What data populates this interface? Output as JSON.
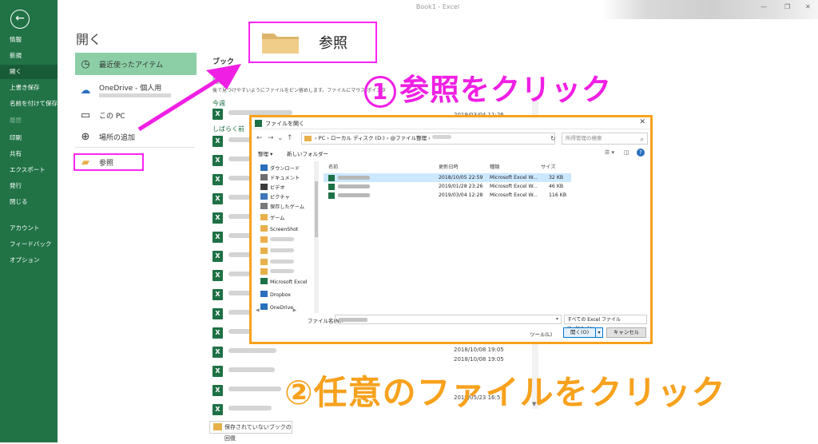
{
  "window": {
    "title": "Book1 - Excel"
  },
  "backstage": {
    "nav": [
      {
        "label": "情報"
      },
      {
        "label": "新規"
      },
      {
        "label": "開く"
      },
      {
        "label": "上書き保存"
      },
      {
        "label": "名前を付けて保存"
      },
      {
        "label": "履歴"
      },
      {
        "label": "印刷"
      },
      {
        "label": "共有"
      },
      {
        "label": "エクスポート"
      },
      {
        "label": "発行"
      },
      {
        "label": "閉じる"
      },
      {
        "label": "アカウント"
      },
      {
        "label": "フィードバック"
      },
      {
        "label": "オプション"
      }
    ],
    "active": "開く"
  },
  "open_pane": {
    "title": "開く",
    "places": {
      "recent": "最近使ったアイテム",
      "onedrive": "OneDrive - 個人用",
      "this_pc": "この PC",
      "add_place": "場所の追加",
      "browse": "参照"
    },
    "recent_header": "ブック",
    "pinned_label": "固定",
    "pinned_tip": "後で見つけやすいようにファイルをピン留めします。ファイルにマウス ポインタ",
    "group_this_week": "今週",
    "group_older": "しばらく前",
    "dates": {
      "d1": "2019/03/04 11:26",
      "d2": "2018/10/08 19:05",
      "d3": "2018/10/08 19:05",
      "d4": "2019/05/23 16:5"
    },
    "recover_button": "保存されていないブックの回復"
  },
  "callout": {
    "browse_label": "参照",
    "step1": "①参照をクリック",
    "step1_text": "参照をクリック",
    "step2_num": "②",
    "step2_text": "任意のファイルをクリック"
  },
  "dialog": {
    "title": "ファイルを開く",
    "address": [
      "PC",
      "ローカル ディスク (D:)",
      "@ファイル整理"
    ],
    "search_placeholder": "所得管理の検索",
    "organize": "整理 ▾",
    "new_folder": "新しいフォルダー",
    "tree": [
      {
        "label": "ダウンロード",
        "icon": "download-icon",
        "color": "#2a6ebd",
        "pin": true
      },
      {
        "label": "ドキュメント",
        "icon": "document-icon",
        "color": "#6d6d6d",
        "pin": true
      },
      {
        "label": "ビデオ",
        "icon": "video-icon",
        "color": "#3b3b3b",
        "pin": true
      },
      {
        "label": "ピクチャ",
        "icon": "picture-icon",
        "color": "#3b77b8",
        "pin": true
      },
      {
        "label": "保存したゲーム",
        "icon": "game-icon",
        "color": "#7a7a7a",
        "pin": true
      },
      {
        "label": "ゲーム",
        "icon": "folder-icon",
        "color": "#e8b04a",
        "pin": false
      },
      {
        "label": "ScreenShot",
        "icon": "folder-icon",
        "color": "#e8b04a",
        "pin": false
      },
      {
        "label": "Microsoft Excel",
        "icon": "excel-icon",
        "color": "#1e7145",
        "pin": false
      },
      {
        "label": "Dropbox",
        "icon": "dropbox-icon",
        "color": "#2a6ebd",
        "pin": false
      },
      {
        "label": "OneDrive",
        "icon": "onedrive-icon",
        "color": "#2a6ebd",
        "pin": false
      }
    ],
    "columns": {
      "name": "名前",
      "date": "更新日時",
      "type": "種類",
      "size": "サイズ"
    },
    "files": [
      {
        "date": "2018/10/05 22:59",
        "type": "Microsoft Excel W...",
        "size": "32 KB",
        "selected": true
      },
      {
        "date": "2019/01/28 23:26",
        "type": "Microsoft Excel W...",
        "size": "46 KB",
        "selected": false
      },
      {
        "date": "2019/03/04 12:28",
        "type": "Microsoft Excel W...",
        "size": "116 KB",
        "selected": false
      }
    ],
    "filename_label": "ファイル名(N):",
    "filetype": "すべての Excel ファイル (*.xl*;*.xlsx",
    "tools": "ツール(L)",
    "open_button": "開く(O)",
    "cancel_button": "キャンセル"
  },
  "colors": {
    "excel_green": "#217346",
    "magenta": "#f01fe4",
    "orange": "#f7a11d"
  }
}
